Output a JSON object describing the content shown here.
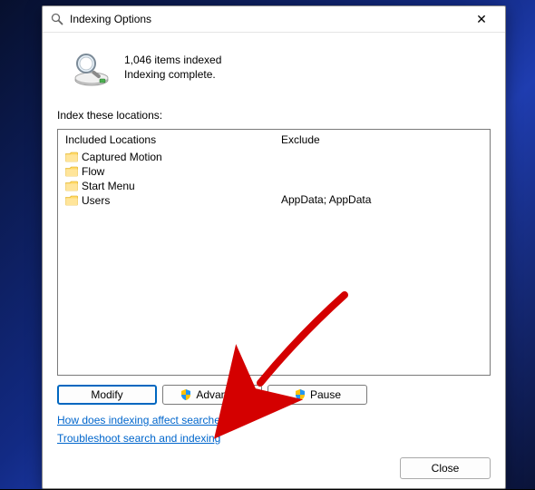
{
  "window": {
    "title": "Indexing Options",
    "close_glyph": "✕"
  },
  "summary": {
    "count_line": "1,046 items indexed",
    "status_line": "Indexing complete."
  },
  "section_label": "Index these locations:",
  "columns": {
    "included_header": "Included Locations",
    "exclude_header": "Exclude"
  },
  "locations": [
    {
      "name": "Captured Motion",
      "exclude": ""
    },
    {
      "name": "Flow",
      "exclude": ""
    },
    {
      "name": "Start Menu",
      "exclude": ""
    },
    {
      "name": "Users",
      "exclude": "AppData; AppData"
    }
  ],
  "buttons": {
    "modify": "Modify",
    "advanced": "Advanced",
    "pause": "Pause",
    "close": "Close"
  },
  "links": {
    "help": "How does indexing affect searches?",
    "troubleshoot": "Troubleshoot search and indexing"
  }
}
